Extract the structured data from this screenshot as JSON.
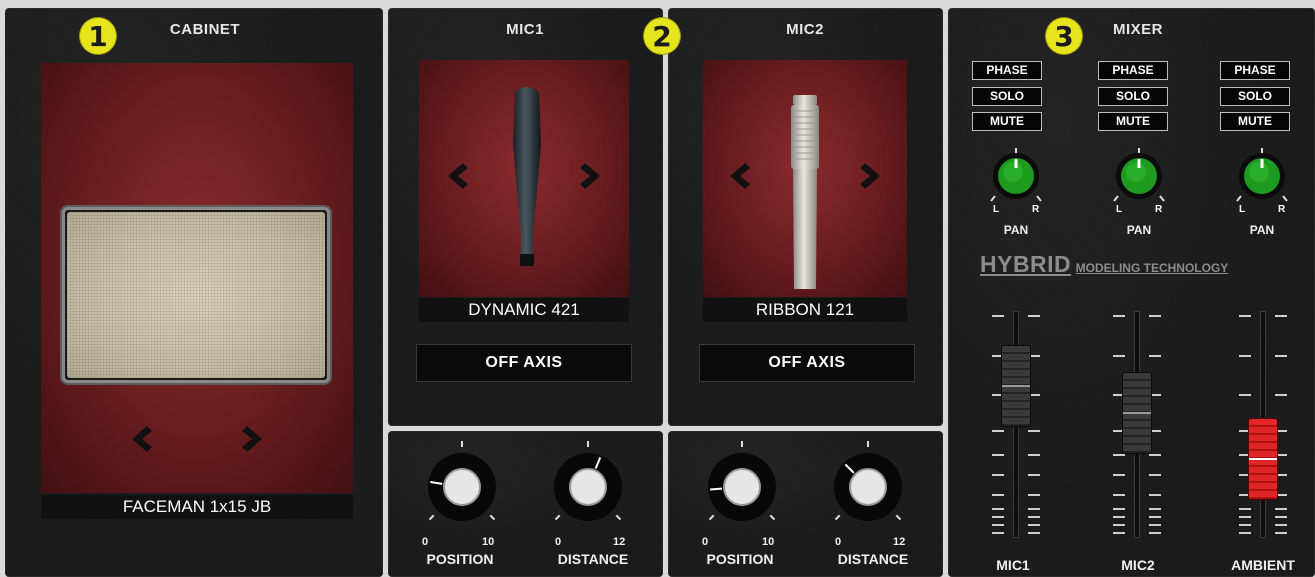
{
  "badges": [
    "1",
    "2",
    "3"
  ],
  "cabinet": {
    "title": "CABINET",
    "name": "FACEMAN 1x15 JB"
  },
  "mic1": {
    "title": "MIC1",
    "name": "DYNAMIC 421",
    "axis": "OFF AXIS",
    "position": {
      "label": "POSITION",
      "min": "0",
      "max": "10",
      "value": 2
    },
    "distance": {
      "label": "DISTANCE",
      "min": "0",
      "max": "12",
      "value": 7
    }
  },
  "mic2": {
    "title": "MIC2",
    "name": "RIBBON 121",
    "axis": "OFF AXIS",
    "position": {
      "label": "POSITION",
      "min": "0",
      "max": "10",
      "value": 1.5
    },
    "distance": {
      "label": "DISTANCE",
      "min": "0",
      "max": "12",
      "value": 4
    }
  },
  "mixer": {
    "title": "MIXER",
    "phase": "PHASE",
    "solo": "SOLO",
    "mute": "MUTE",
    "pan": "PAN",
    "pan_l": "L",
    "pan_r": "R",
    "brand": "HYBRID",
    "brand_sub": "MODELING TECHNOLOGY",
    "channels": [
      "MIC1",
      "MIC2",
      "AMBIENT"
    ],
    "fader_levels": [
      0.67,
      0.55,
      0.35
    ]
  },
  "colors": {
    "badge": "#e6e51d",
    "pan_knob": "#1f9a1f",
    "ambient_fader": "#c81818",
    "panel_red": "#7a2224"
  }
}
